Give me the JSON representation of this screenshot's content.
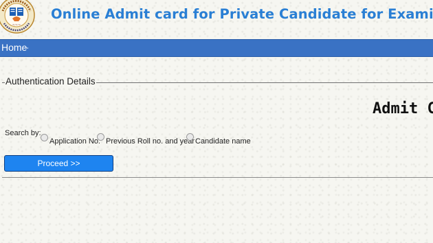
{
  "header": {
    "title": "Online Admit card for Private Candidate for Examination Mai",
    "logo_icon": "cbse-emblem-icon"
  },
  "nav": {
    "home_label": "Home",
    "separator": "-"
  },
  "form": {
    "legend": "Authentication Details",
    "admit_heading": "Admit C",
    "search_by_label": "Search by:",
    "options": [
      {
        "label": "Application No."
      },
      {
        "label": "Previous Roll no. and year"
      },
      {
        "label": "Candidate name"
      }
    ],
    "proceed_label": "Proceed >>"
  },
  "colors": {
    "title": "#2a7fd4",
    "navbar": "#3a72c4",
    "button": "#1e84f0"
  }
}
